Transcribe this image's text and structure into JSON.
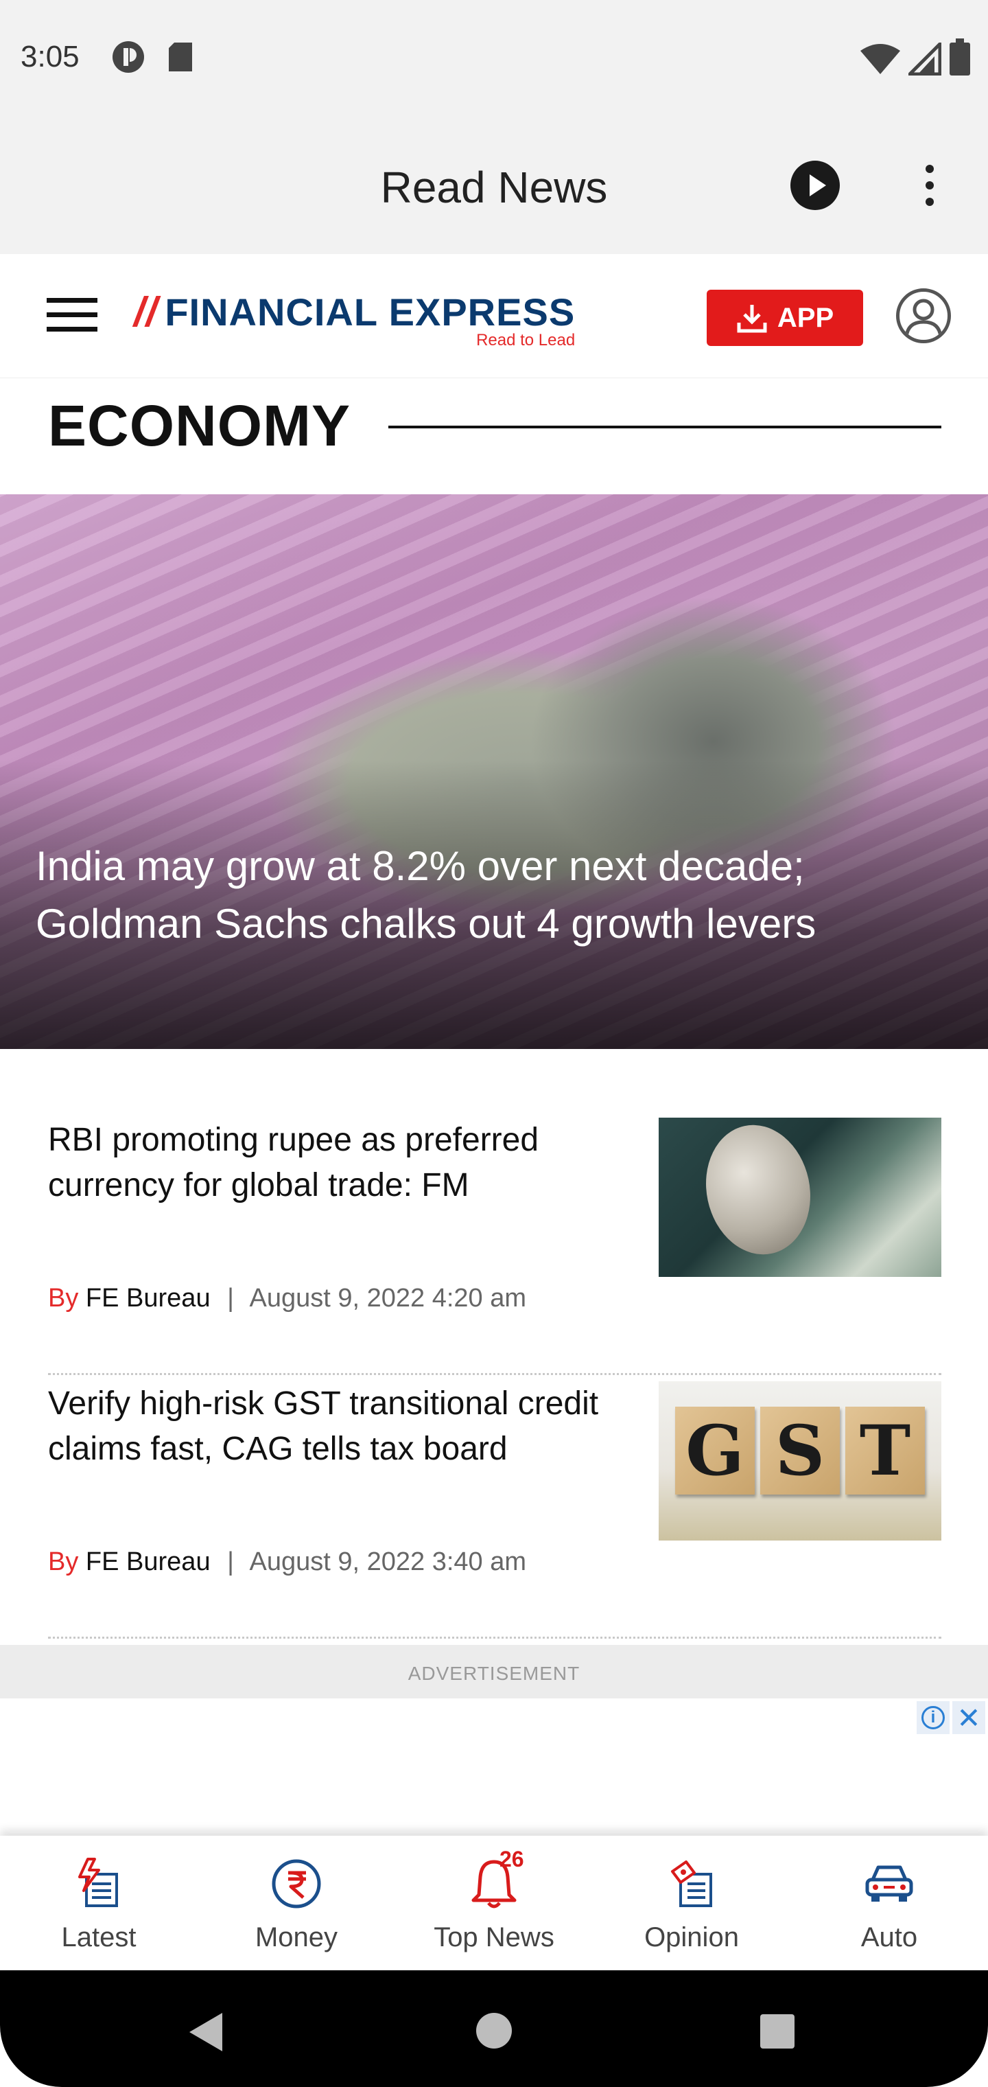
{
  "status_bar": {
    "time": "3:05",
    "icons": [
      "data-saver-icon",
      "sd-card-icon",
      "wifi-icon",
      "signal-icon",
      "battery-icon"
    ]
  },
  "app_bar": {
    "title": "Read News",
    "play_icon": "play-circle-icon",
    "more_icon": "more-vertical-icon"
  },
  "site_header": {
    "logo_text": "FINANCIAL EXPRESS",
    "logo_tagline": "Read to Lead",
    "app_button_label": "APP",
    "menu_icon": "hamburger-menu-icon",
    "user_icon": "user-account-icon"
  },
  "section": {
    "title": "ECONOMY"
  },
  "hero": {
    "title": "India may grow at 8.2% over next decade; Goldman Sachs chalks out 4 growth levers"
  },
  "articles": [
    {
      "title": "RBI promoting rupee as preferred currency for global trade: FM",
      "by": "By",
      "author": "FE Bureau",
      "separator": "|",
      "date": "August 9, 2022 4:20 am"
    },
    {
      "title": "Verify high-risk GST transitional credit claims fast, CAG tells tax board",
      "by": "By",
      "author": "FE Bureau",
      "separator": "|",
      "date": "August 9, 2022 3:40 am",
      "thumb_letters": [
        "G",
        "S",
        "T"
      ]
    }
  ],
  "advertisement": {
    "label": "ADVERTISEMENT",
    "info_icon": "i",
    "close_icon": "✕"
  },
  "bottom_nav": {
    "items": [
      {
        "label": "Latest",
        "icon": "latest-news-icon"
      },
      {
        "label": "Money",
        "icon": "rupee-icon"
      },
      {
        "label": "Top News",
        "icon": "bell-icon",
        "badge": "26"
      },
      {
        "label": "Opinion",
        "icon": "opinion-icon"
      },
      {
        "label": "Auto",
        "icon": "car-icon"
      }
    ]
  },
  "colors": {
    "brand_red": "#e21b1b",
    "brand_blue": "#0b3a6e",
    "accent_icon_red": "#d81b1b",
    "accent_icon_blue": "#1b4f8c"
  }
}
